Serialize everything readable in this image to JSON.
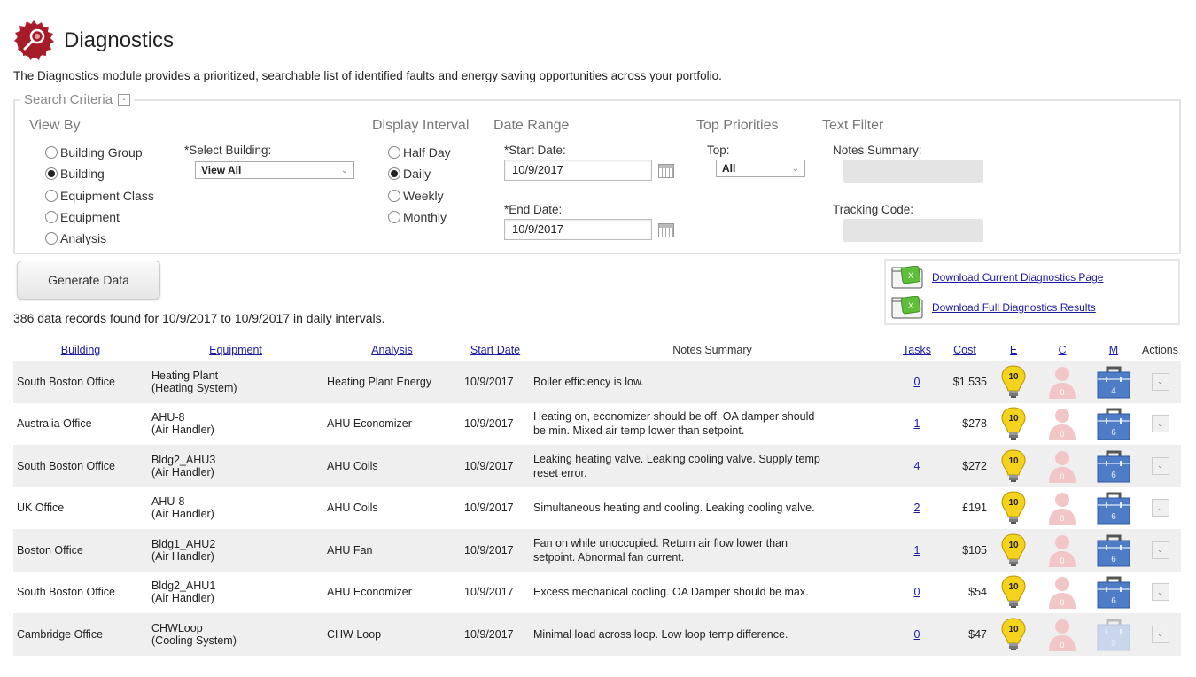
{
  "header": {
    "title": "Diagnostics",
    "description": "The Diagnostics module provides a prioritized, searchable list of identified faults and energy saving opportunities across your portfolio."
  },
  "search_criteria": {
    "legend": "Search Criteria",
    "collapse_symbol": "-",
    "view_by": {
      "heading": "View By",
      "options": [
        {
          "label": "Building Group",
          "selected": false
        },
        {
          "label": "Building",
          "selected": true
        },
        {
          "label": "Equipment Class",
          "selected": false
        },
        {
          "label": "Equipment",
          "selected": false
        },
        {
          "label": "Analysis",
          "selected": false
        }
      ],
      "select_label": "*Select Building:",
      "select_value": "View All"
    },
    "display_interval": {
      "heading": "Display Interval",
      "options": [
        {
          "label": "Half Day",
          "selected": false
        },
        {
          "label": "Daily",
          "selected": true
        },
        {
          "label": "Weekly",
          "selected": false
        },
        {
          "label": "Monthly",
          "selected": false
        }
      ]
    },
    "date_range": {
      "heading": "Date Range",
      "start_label": "*Start Date:",
      "start_value": "10/9/2017",
      "end_label": "*End Date:",
      "end_value": "10/9/2017"
    },
    "top_priorities": {
      "heading": "Top Priorities",
      "top_label": "Top:",
      "top_value": "All"
    },
    "text_filter": {
      "heading": "Text Filter",
      "notes_label": "Notes Summary:",
      "notes_value": "",
      "tracking_label": "Tracking Code:",
      "tracking_value": ""
    }
  },
  "actions": {
    "generate_label": "Generate Data",
    "records_text": "386 data records found for 10/9/2017 to 10/9/2017 in daily intervals.",
    "download_current": "Download Current Diagnostics Page",
    "download_full": "Download Full Diagnostics Results"
  },
  "table": {
    "headers": {
      "building": "Building",
      "equipment": "Equipment",
      "analysis": "Analysis",
      "start_date": "Start Date",
      "notes": "Notes Summary",
      "tasks": "Tasks",
      "cost": "Cost",
      "e": "E",
      "c": "C",
      "m": "M",
      "actions": "Actions"
    },
    "rows": [
      {
        "building": "South Boston Office",
        "equipment": "Heating Plant",
        "equipment_type": "(Heating System)",
        "analysis": "Heating Plant Energy",
        "start_date": "10/9/2017",
        "notes": "Boiler efficiency is low.",
        "tasks": "0",
        "cost": "$1,535",
        "e": "10",
        "c": "0",
        "m": "4"
      },
      {
        "building": "Australia Office",
        "equipment": "AHU-8",
        "equipment_type": "(Air Handler)",
        "analysis": "AHU Economizer",
        "start_date": "10/9/2017",
        "notes": "Heating on, economizer should be off. OA damper should be min. Mixed air temp lower than setpoint.",
        "tasks": "1",
        "cost": "$278",
        "e": "10",
        "c": "0",
        "m": "6"
      },
      {
        "building": "South Boston Office",
        "equipment": "Bldg2_AHU3",
        "equipment_type": "(Air Handler)",
        "analysis": "AHU Coils",
        "start_date": "10/9/2017",
        "notes": "Leaking heating valve. Leaking cooling valve. Supply temp reset error.",
        "tasks": "4",
        "cost": "$272",
        "e": "10",
        "c": "0",
        "m": "6"
      },
      {
        "building": "UK Office",
        "equipment": "AHU-8",
        "equipment_type": "(Air Handler)",
        "analysis": "AHU Coils",
        "start_date": "10/9/2017",
        "notes": "Simultaneous heating and cooling. Leaking cooling valve.",
        "tasks": "2",
        "cost": "£191",
        "e": "10",
        "c": "0",
        "m": "6"
      },
      {
        "building": "Boston Office",
        "equipment": "Bldg1_AHU2",
        "equipment_type": "(Air Handler)",
        "analysis": "AHU Fan",
        "start_date": "10/9/2017",
        "notes": "Fan on while unoccupied. Return air flow lower than setpoint. Abnormal fan current.",
        "tasks": "1",
        "cost": "$105",
        "e": "10",
        "c": "0",
        "m": "6"
      },
      {
        "building": "South Boston Office",
        "equipment": "Bldg2_AHU1",
        "equipment_type": "(Air Handler)",
        "analysis": "AHU Economizer",
        "start_date": "10/9/2017",
        "notes": "Excess mechanical cooling. OA Damper should be max.",
        "tasks": "0",
        "cost": "$54",
        "e": "10",
        "c": "0",
        "m": "6"
      },
      {
        "building": "Cambridge Office",
        "equipment": "CHWLoop",
        "equipment_type": "(Cooling System)",
        "analysis": "CHW Loop",
        "start_date": "10/9/2017",
        "notes": "Minimal load across loop. Low loop temp difference.",
        "tasks": "0",
        "cost": "$47",
        "e": "10",
        "c": "0",
        "m": "0"
      }
    ]
  },
  "colors": {
    "brand_red": "#b3202e",
    "link_blue": "#1a1aa6",
    "bulb_yellow": "#f5d21c",
    "person_faded": "#f2c6c6",
    "toolbox_blue": "#4f7cc6",
    "toolbox_faded": "#c9d6ec",
    "row_alt": "#efefef"
  }
}
